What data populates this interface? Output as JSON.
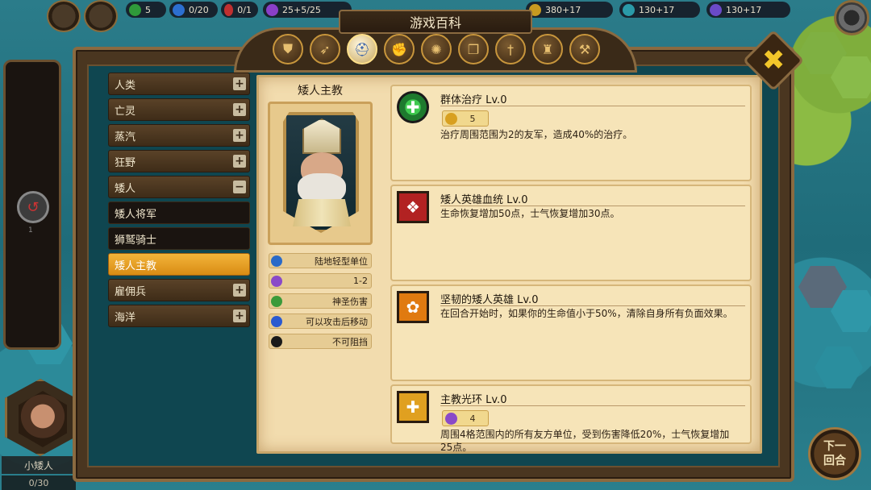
{
  "topbar": {
    "resources": [
      {
        "icon": "leaf-icon",
        "color": "#2f9a3a",
        "value": "5"
      },
      {
        "icon": "person-icon",
        "color": "#2c6fd0",
        "value": "0/20"
      },
      {
        "icon": "sword-icon",
        "color": "#c03030",
        "value": "0/1"
      },
      {
        "icon": "swirl-icon",
        "color": "#8a3fc8",
        "value": "25+5/25"
      },
      {
        "icon": "coin-icon",
        "color": "#c89a20",
        "value": "380+17"
      },
      {
        "icon": "book-icon",
        "color": "#2a9aa8",
        "value": "130+17"
      },
      {
        "icon": "flask-icon",
        "color": "#6a4ac8",
        "value": "130+17"
      }
    ]
  },
  "panel": {
    "title": "游戏百科",
    "close_label": "✖"
  },
  "categories": [
    {
      "name": "shield-icon",
      "glyph": "⛊",
      "active": false
    },
    {
      "name": "feather-icon",
      "glyph": "➶",
      "active": false
    },
    {
      "name": "helmet-icon",
      "glyph": "⛑",
      "active": true
    },
    {
      "name": "fist-icon",
      "glyph": "✊",
      "active": false
    },
    {
      "name": "swirl-icon",
      "glyph": "✺",
      "active": false
    },
    {
      "name": "book-icon",
      "glyph": "❐",
      "active": false
    },
    {
      "name": "sword-icon",
      "glyph": "†",
      "active": false
    },
    {
      "name": "tower-icon",
      "glyph": "♜",
      "active": false
    },
    {
      "name": "hammer-icon",
      "glyph": "⚒",
      "active": false
    }
  ],
  "races": [
    {
      "label": "人类",
      "toggle": "+",
      "kind": "race"
    },
    {
      "label": "亡灵",
      "toggle": "+",
      "kind": "race"
    },
    {
      "label": "蒸汽",
      "toggle": "+",
      "kind": "race"
    },
    {
      "label": "狂野",
      "toggle": "+",
      "kind": "race"
    },
    {
      "label": "矮人",
      "toggle": "−",
      "kind": "race"
    },
    {
      "label": "矮人将军",
      "toggle": "",
      "kind": "sub"
    },
    {
      "label": "狮鹫骑士",
      "toggle": "",
      "kind": "sub"
    },
    {
      "label": "矮人主教",
      "toggle": "",
      "kind": "active"
    },
    {
      "label": "雇佣兵",
      "toggle": "+",
      "kind": "race"
    },
    {
      "label": "海洋",
      "toggle": "+",
      "kind": "race"
    }
  ],
  "unit": {
    "name": "矮人主教",
    "attributes": [
      {
        "icon": "unit-type-icon",
        "color": "#2a6ac8",
        "text": "陆地轻型单位"
      },
      {
        "icon": "range-icon",
        "color": "#8a4ac8",
        "text": "1-2"
      },
      {
        "icon": "holy-damage-icon",
        "color": "#3a9a3a",
        "text": "神圣伤害"
      },
      {
        "icon": "move-after-attack-icon",
        "color": "#2a5ad0",
        "text": "可以攻击后移动"
      },
      {
        "icon": "unstoppable-icon",
        "color": "#1a1a1a",
        "text": "不可阻挡"
      }
    ]
  },
  "skills": [
    {
      "name": "群体治疗 Lv.0",
      "icon": "heal-icon",
      "icon_bg": "#1e7a2e",
      "badge": {
        "icon": "cooldown-icon",
        "color": "#d8a020",
        "value": "5"
      },
      "desc": "治疗周围范围为2的友军，造成40%的治疗。"
    },
    {
      "name": "矮人英雄血统 Lv.0",
      "icon": "bloodline-icon",
      "icon_bg": "#b22222",
      "badge": null,
      "desc": "生命恢复增加50点，士气恢复增加30点。"
    },
    {
      "name": "坚韧的矮人英雄 Lv.0",
      "icon": "tenacity-icon",
      "icon_bg": "#e07a10",
      "badge": null,
      "desc": "在回合开始时，如果你的生命值小于50%，清除自身所有负面效果。"
    },
    {
      "name": "主教光环 Lv.0",
      "icon": "aura-icon",
      "icon_bg": "#e0a020",
      "badge": {
        "icon": "range-icon",
        "color": "#8a4ac8",
        "value": "4"
      },
      "desc": "周围4格范围内的所有友方单位，受到伤害降低20%，士气恢复增加25点。"
    }
  ],
  "hero": {
    "name": "小矮人",
    "count": "0/30"
  },
  "left_rail": {
    "badge": "1"
  },
  "next_turn": {
    "label": "下一回合"
  }
}
